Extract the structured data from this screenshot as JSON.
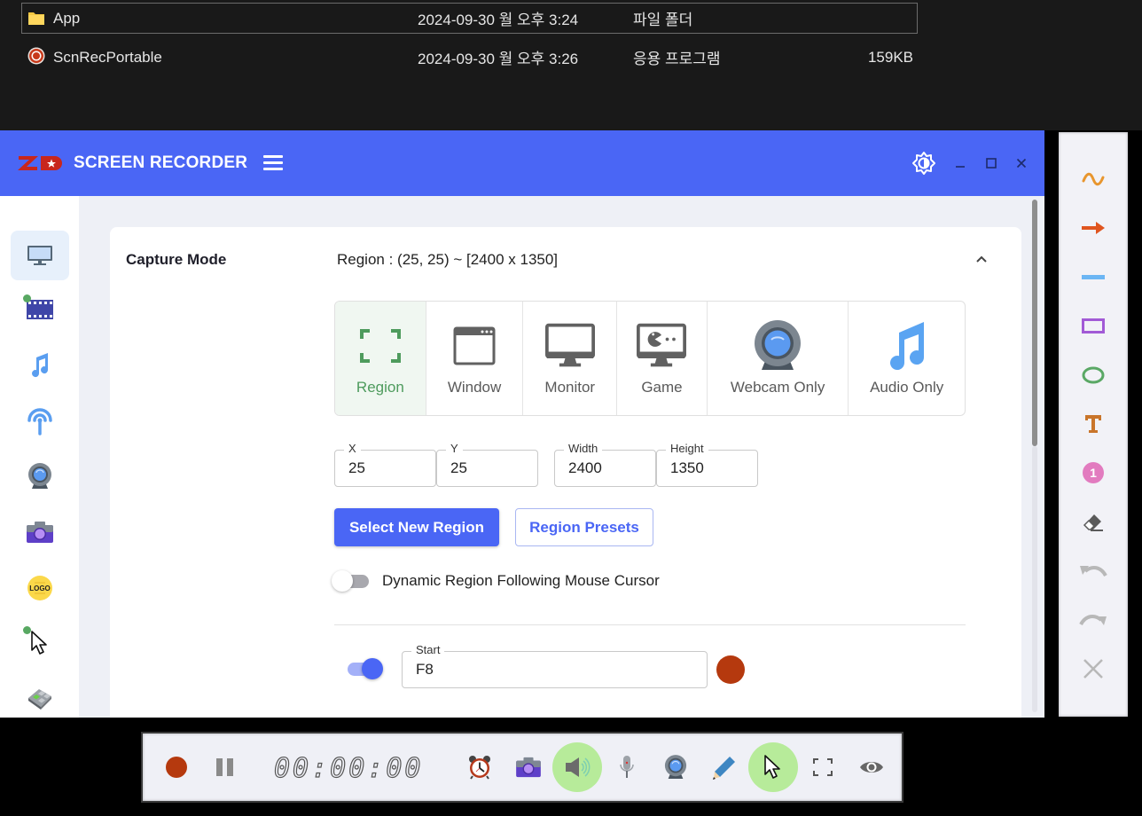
{
  "explorer": {
    "rows": [
      {
        "name": "App",
        "date": "2024-09-30 월 오후 3:24",
        "type": "파일 폴더",
        "size": "",
        "icon": "folder-icon",
        "selected": true
      },
      {
        "name": "ScnRecPortable",
        "date": "2024-09-30 월 오후 3:26",
        "type": "응용 프로그램",
        "size": "159KB",
        "icon": "app-record-icon",
        "selected": false
      }
    ]
  },
  "app": {
    "logo": "ZD",
    "title": "SCREEN RECORDER",
    "brand_color": "#4a66f5",
    "window_controls": {
      "minimize": "minimize",
      "maximize": "maximize",
      "close": "close"
    }
  },
  "sidebar": {
    "items": [
      {
        "id": "screen",
        "icon": "monitor-icon",
        "active": true,
        "dot": false
      },
      {
        "id": "video",
        "icon": "film-icon",
        "active": false,
        "dot": true
      },
      {
        "id": "audio",
        "icon": "music-note-icon",
        "active": false,
        "dot": false
      },
      {
        "id": "broadcast",
        "icon": "broadcast-icon",
        "active": false,
        "dot": false
      },
      {
        "id": "webcam",
        "icon": "webcam-icon",
        "active": false,
        "dot": false
      },
      {
        "id": "screenshot",
        "icon": "camera-icon",
        "active": false,
        "dot": false
      },
      {
        "id": "logo",
        "icon": "logo-badge-icon",
        "active": false,
        "dot": false,
        "text": "LOGO"
      },
      {
        "id": "cursor",
        "icon": "cursor-icon",
        "active": false,
        "dot": true
      },
      {
        "id": "keyboard",
        "icon": "keyboard-icon",
        "active": false,
        "dot": false
      }
    ]
  },
  "capture": {
    "label": "Capture Mode",
    "summary": "Region : (25, 25) ~ [2400 x 1350]",
    "modes": [
      {
        "label": "Region",
        "icon": "region-corners-icon",
        "active": true
      },
      {
        "label": "Window",
        "icon": "window-icon",
        "active": false
      },
      {
        "label": "Monitor",
        "icon": "monitor-icon",
        "active": false
      },
      {
        "label": "Game",
        "icon": "game-monitor-icon",
        "active": false
      },
      {
        "label": "Webcam Only",
        "icon": "webcam-icon",
        "active": false
      },
      {
        "label": "Audio Only",
        "icon": "music-note-icon",
        "active": false
      }
    ],
    "fields": {
      "x": {
        "label": "X",
        "value": "25"
      },
      "y": {
        "label": "Y",
        "value": "25"
      },
      "width": {
        "label": "Width",
        "value": "2400"
      },
      "height": {
        "label": "Height",
        "value": "1350"
      }
    },
    "select_region_label": "Select New Region",
    "region_presets_label": "Region Presets",
    "dynamic_region_label": "Dynamic Region Following Mouse Cursor",
    "dynamic_region_on": false,
    "hotkey": {
      "enabled": true,
      "label": "Start",
      "value": "F8",
      "color": "#b5390e"
    }
  },
  "draw_toolbar": {
    "tools": [
      {
        "name": "freehand",
        "icon": "freehand-wave-icon",
        "color": "#e8962e"
      },
      {
        "name": "arrow",
        "icon": "arrow-right-icon",
        "color": "#e0551f"
      },
      {
        "name": "line",
        "icon": "line-icon",
        "color": "#6cb6f4"
      },
      {
        "name": "rectangle",
        "icon": "rectangle-icon",
        "color": "#a25ad6"
      },
      {
        "name": "ellipse",
        "icon": "ellipse-icon",
        "color": "#5aa865"
      },
      {
        "name": "text",
        "icon": "text-t-icon",
        "color": "#c9752a"
      },
      {
        "name": "number",
        "icon": "number-badge-icon",
        "color": "#e27bbf",
        "text": "1"
      },
      {
        "name": "eraser",
        "icon": "eraser-icon",
        "color": "#555555"
      },
      {
        "name": "undo",
        "icon": "undo-icon",
        "color": "#b8b8b8"
      },
      {
        "name": "redo",
        "icon": "redo-icon",
        "color": "#b8b8b8"
      },
      {
        "name": "close",
        "icon": "close-icon",
        "color": "#b8b8b8"
      }
    ]
  },
  "rec_bar": {
    "timer": "00:00:00",
    "record_color": "#b5390e",
    "items": [
      {
        "name": "record",
        "icon": "record-icon",
        "active": false
      },
      {
        "name": "pause",
        "icon": "pause-icon",
        "active": false
      },
      {
        "name": "schedule",
        "icon": "alarm-clock-icon",
        "active": false
      },
      {
        "name": "screenshot",
        "icon": "camera-icon",
        "active": false
      },
      {
        "name": "speaker",
        "icon": "speaker-icon",
        "active": true
      },
      {
        "name": "microphone",
        "icon": "microphone-icon",
        "active": false
      },
      {
        "name": "webcam",
        "icon": "webcam-icon",
        "active": false
      },
      {
        "name": "draw",
        "icon": "pencil-icon",
        "active": false
      },
      {
        "name": "cursor",
        "icon": "cursor-icon",
        "active": true
      },
      {
        "name": "region",
        "icon": "region-corners-icon",
        "active": false
      },
      {
        "name": "preview",
        "icon": "eye-icon",
        "active": false
      }
    ]
  }
}
